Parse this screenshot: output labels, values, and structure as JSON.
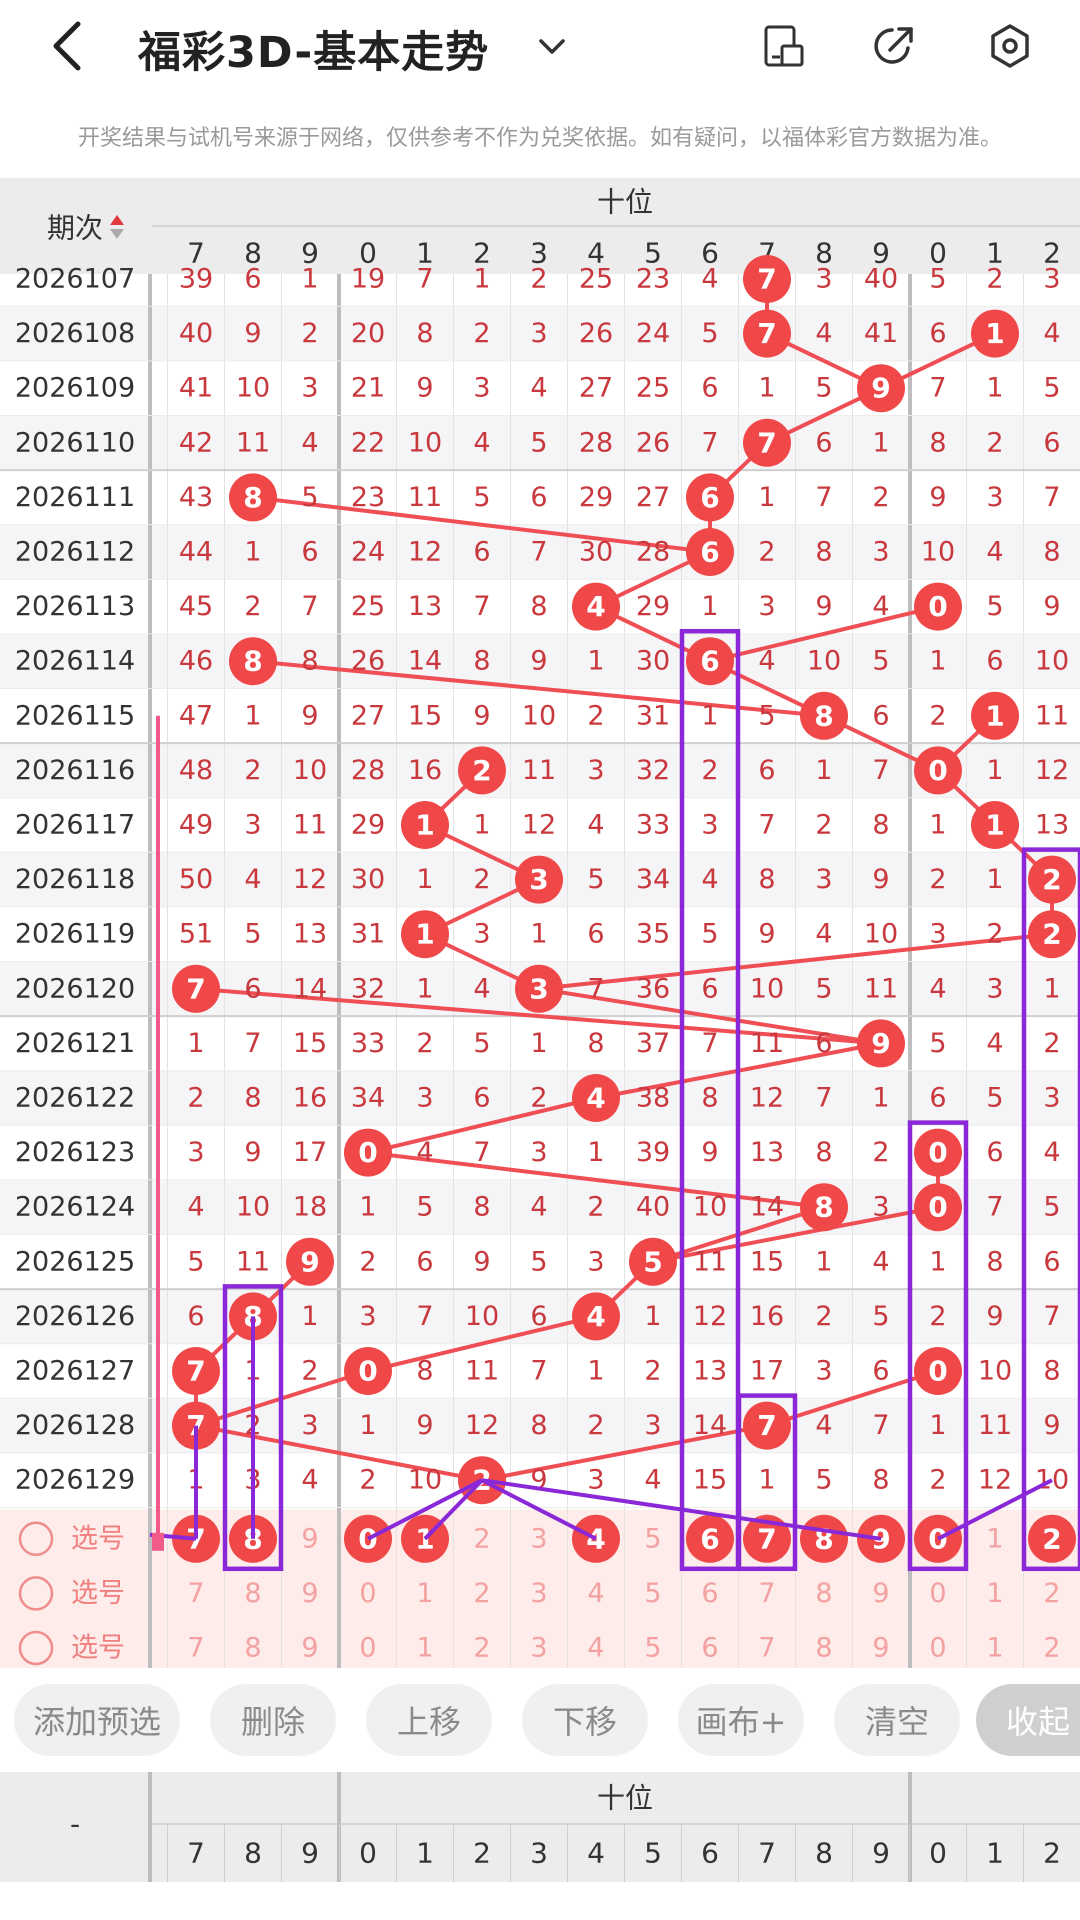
{
  "header": {
    "title": "福彩3D-基本走势",
    "disclaimer": "开奖结果与试机号来源于网络，仅供参考不作为兑奖依据。如有疑问，以福体彩官方数据为准。"
  },
  "table": {
    "period_header": "期次",
    "group_label": "十位",
    "columns": [
      "7",
      "8",
      "9",
      "0",
      "1",
      "2",
      "3",
      "4",
      "5",
      "6",
      "7",
      "8",
      "9",
      "0",
      "1",
      "2"
    ],
    "rows": [
      {
        "period": "2026107",
        "cells": [
          "39",
          "6",
          "1",
          "19",
          "7",
          "1",
          "2",
          "25",
          "23",
          "4",
          "7",
          "3",
          "40",
          "5",
          "2",
          "3"
        ],
        "hits": [
          10
        ]
      },
      {
        "period": "2026108",
        "cells": [
          "40",
          "9",
          "2",
          "20",
          "8",
          "2",
          "3",
          "26",
          "24",
          "5",
          "7",
          "4",
          "41",
          "6",
          "1",
          "4"
        ],
        "hits": [
          10,
          14
        ]
      },
      {
        "period": "2026109",
        "cells": [
          "41",
          "10",
          "3",
          "21",
          "9",
          "3",
          "4",
          "27",
          "25",
          "6",
          "1",
          "5",
          "9",
          "7",
          "1",
          "5"
        ],
        "hits": [
          12
        ]
      },
      {
        "period": "2026110",
        "cells": [
          "42",
          "11",
          "4",
          "22",
          "10",
          "4",
          "5",
          "28",
          "26",
          "7",
          "7",
          "6",
          "1",
          "8",
          "2",
          "6"
        ],
        "hits": [
          10
        ]
      },
      {
        "period": "2026111",
        "cells": [
          "43",
          "8",
          "5",
          "23",
          "11",
          "5",
          "6",
          "29",
          "27",
          "6",
          "1",
          "7",
          "2",
          "9",
          "3",
          "7"
        ],
        "hits": [
          1,
          9
        ]
      },
      {
        "period": "2026112",
        "cells": [
          "44",
          "1",
          "6",
          "24",
          "12",
          "6",
          "7",
          "30",
          "28",
          "6",
          "2",
          "8",
          "3",
          "10",
          "4",
          "8"
        ],
        "hits": [
          9
        ]
      },
      {
        "period": "2026113",
        "cells": [
          "45",
          "2",
          "7",
          "25",
          "13",
          "7",
          "8",
          "4",
          "29",
          "1",
          "3",
          "9",
          "4",
          "0",
          "5",
          "9"
        ],
        "hits": [
          7,
          13
        ]
      },
      {
        "period": "2026114",
        "cells": [
          "46",
          "8",
          "8",
          "26",
          "14",
          "8",
          "9",
          "1",
          "30",
          "6",
          "4",
          "10",
          "5",
          "1",
          "6",
          "10"
        ],
        "hits": [
          1,
          9
        ]
      },
      {
        "period": "2026115",
        "cells": [
          "47",
          "1",
          "9",
          "27",
          "15",
          "9",
          "10",
          "2",
          "31",
          "1",
          "5",
          "8",
          "6",
          "2",
          "1",
          "11"
        ],
        "hits": [
          11,
          14
        ]
      },
      {
        "period": "2026116",
        "cells": [
          "48",
          "2",
          "10",
          "28",
          "16",
          "2",
          "11",
          "3",
          "32",
          "2",
          "6",
          "1",
          "7",
          "0",
          "1",
          "12"
        ],
        "hits": [
          5,
          13
        ]
      },
      {
        "period": "2026117",
        "cells": [
          "49",
          "3",
          "11",
          "29",
          "1",
          "1",
          "12",
          "4",
          "33",
          "3",
          "7",
          "2",
          "8",
          "1",
          "1",
          "13"
        ],
        "hits": [
          4,
          14
        ]
      },
      {
        "period": "2026118",
        "cells": [
          "50",
          "4",
          "12",
          "30",
          "1",
          "2",
          "3",
          "5",
          "34",
          "4",
          "8",
          "3",
          "9",
          "2",
          "1",
          "2"
        ],
        "hits": [
          6,
          15
        ]
      },
      {
        "period": "2026119",
        "cells": [
          "51",
          "5",
          "13",
          "31",
          "1",
          "3",
          "1",
          "6",
          "35",
          "5",
          "9",
          "4",
          "10",
          "3",
          "2",
          "2"
        ],
        "hits": [
          4,
          15
        ]
      },
      {
        "period": "2026120",
        "cells": [
          "7",
          "6",
          "14",
          "32",
          "1",
          "4",
          "3",
          "7",
          "36",
          "6",
          "10",
          "5",
          "11",
          "4",
          "3",
          "1"
        ],
        "hits": [
          0,
          6
        ]
      },
      {
        "period": "2026121",
        "cells": [
          "1",
          "7",
          "15",
          "33",
          "2",
          "5",
          "1",
          "8",
          "37",
          "7",
          "11",
          "6",
          "9",
          "5",
          "4",
          "2"
        ],
        "hits": [
          12
        ]
      },
      {
        "period": "2026122",
        "cells": [
          "2",
          "8",
          "16",
          "34",
          "3",
          "6",
          "2",
          "4",
          "38",
          "8",
          "12",
          "7",
          "1",
          "6",
          "5",
          "3"
        ],
        "hits": [
          7
        ]
      },
      {
        "period": "2026123",
        "cells": [
          "3",
          "9",
          "17",
          "0",
          "4",
          "7",
          "3",
          "1",
          "39",
          "9",
          "13",
          "8",
          "2",
          "0",
          "6",
          "4"
        ],
        "hits": [
          3,
          13
        ]
      },
      {
        "period": "2026124",
        "cells": [
          "4",
          "10",
          "18",
          "1",
          "5",
          "8",
          "4",
          "2",
          "40",
          "10",
          "14",
          "8",
          "3",
          "0",
          "7",
          "5"
        ],
        "hits": [
          11,
          13
        ]
      },
      {
        "period": "2026125",
        "cells": [
          "5",
          "11",
          "9",
          "2",
          "6",
          "9",
          "5",
          "3",
          "5",
          "11",
          "15",
          "1",
          "4",
          "1",
          "8",
          "6"
        ],
        "hits": [
          2,
          8
        ]
      },
      {
        "period": "2026126",
        "cells": [
          "6",
          "8",
          "1",
          "3",
          "7",
          "10",
          "6",
          "4",
          "1",
          "12",
          "16",
          "2",
          "5",
          "2",
          "9",
          "7"
        ],
        "hits": [
          1,
          7
        ]
      },
      {
        "period": "2026127",
        "cells": [
          "7",
          "1",
          "2",
          "0",
          "8",
          "11",
          "7",
          "1",
          "2",
          "13",
          "17",
          "3",
          "6",
          "0",
          "10",
          "8"
        ],
        "hits": [
          0,
          3,
          13
        ]
      },
      {
        "period": "2026128",
        "cells": [
          "7",
          "2",
          "3",
          "1",
          "9",
          "12",
          "8",
          "2",
          "3",
          "14",
          "7",
          "4",
          "7",
          "1",
          "11",
          "9"
        ],
        "hits": [
          0,
          10
        ]
      },
      {
        "period": "2026129",
        "cells": [
          "1",
          "3",
          "4",
          "2",
          "10",
          "2",
          "9",
          "3",
          "4",
          "15",
          "1",
          "5",
          "8",
          "2",
          "12",
          "10"
        ],
        "hits": [
          5
        ]
      }
    ],
    "select_rows": [
      {
        "label": "选号",
        "cells": [
          "7",
          "8",
          "9",
          "0",
          "1",
          "2",
          "3",
          "4",
          "5",
          "6",
          "7",
          "8",
          "9",
          "0",
          "1",
          "2"
        ],
        "picked": [
          0,
          1,
          3,
          4,
          7,
          9,
          10,
          11,
          12,
          13,
          15
        ]
      },
      {
        "label": "选号",
        "cells": [
          "7",
          "8",
          "9",
          "0",
          "1",
          "2",
          "3",
          "4",
          "5",
          "6",
          "7",
          "8",
          "9",
          "0",
          "1",
          "2"
        ],
        "picked": []
      },
      {
        "label": "选号",
        "cells": [
          "7",
          "8",
          "9",
          "0",
          "1",
          "2",
          "3",
          "4",
          "5",
          "6",
          "7",
          "8",
          "9",
          "0",
          "1",
          "2"
        ],
        "picked": []
      }
    ],
    "footer_first_cell": "-"
  },
  "buttons": {
    "add": "添加预选",
    "delete": "删除",
    "up": "上移",
    "down": "下移",
    "canvas": "画布+",
    "clear": "清空",
    "collapse": "收起"
  },
  "colors": {
    "ball": "#f04848",
    "line": "#ef4e55",
    "number": "#c8383d",
    "box": "#8a28d8",
    "pink": "#f25a8a"
  }
}
